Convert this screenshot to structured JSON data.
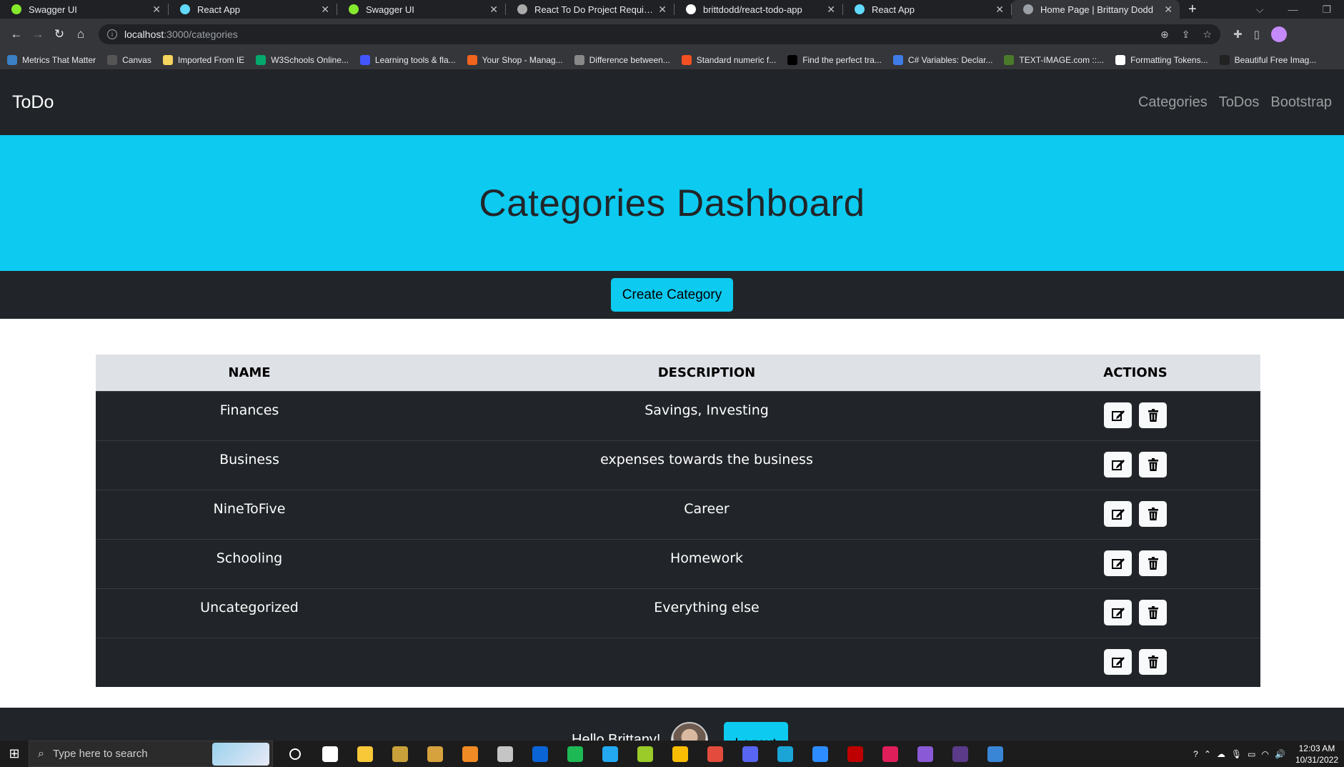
{
  "browser": {
    "tabs": [
      {
        "title": "Swagger UI",
        "icon": "swagger-icon",
        "color": "#85ea2d"
      },
      {
        "title": "React App",
        "icon": "react-icon",
        "color": "#61dafb"
      },
      {
        "title": "Swagger UI",
        "icon": "swagger-icon",
        "color": "#85ea2d"
      },
      {
        "title": "React To Do Project Requiremen",
        "icon": "canvas-icon",
        "color": "#aaaaaa"
      },
      {
        "title": "brittdodd/react-todo-app",
        "icon": "github-icon",
        "color": "#ffffff"
      },
      {
        "title": "React App",
        "icon": "react-icon",
        "color": "#61dafb"
      },
      {
        "title": "Home Page | Brittany Dodd",
        "icon": "globe-icon",
        "color": "#9aa0a6"
      }
    ],
    "active_tab": 6,
    "close_glyph": "✕",
    "new_tab_glyph": "+",
    "address": {
      "host": "localhost",
      "path": ":3000/categories"
    },
    "bookmarks": [
      {
        "label": "Metrics That Matter",
        "color": "#3b7fc4"
      },
      {
        "label": "Canvas",
        "color": "#555555"
      },
      {
        "label": "Imported From IE",
        "color": "#f4d35e"
      },
      {
        "label": "W3Schools Online...",
        "color": "#04aa6d"
      },
      {
        "label": "Learning tools & fla...",
        "color": "#4255ff"
      },
      {
        "label": "Your Shop - Manag...",
        "color": "#f1641e"
      },
      {
        "label": "Difference between...",
        "color": "#888888"
      },
      {
        "label": "Standard numeric f...",
        "color": "#f25022"
      },
      {
        "label": "Find the perfect tra...",
        "color": "#000000"
      },
      {
        "label": "C# Variables: Declar...",
        "color": "#3f7ce8"
      },
      {
        "label": "TEXT-IMAGE.com ::...",
        "color": "#4a7a2a"
      },
      {
        "label": "Formatting Tokens...",
        "color": "#ffffff"
      },
      {
        "label": "Beautiful Free Imag...",
        "color": "#222222"
      }
    ]
  },
  "navbar": {
    "brand": "ToDo",
    "links": [
      "Categories",
      "ToDos",
      "Bootstrap"
    ]
  },
  "hero": {
    "title": "Categories Dashboard"
  },
  "create_button": "Create Category",
  "table": {
    "headers": [
      "NAME",
      "DESCRIPTION",
      "ACTIONS"
    ],
    "rows": [
      {
        "name": "Finances",
        "description": "Savings, Investing"
      },
      {
        "name": "Business",
        "description": "expenses towards the business"
      },
      {
        "name": "NineToFive",
        "description": "Career"
      },
      {
        "name": "Schooling",
        "description": "Homework"
      },
      {
        "name": "Uncategorized",
        "description": "Everything else"
      },
      {
        "name": "",
        "description": ""
      }
    ]
  },
  "footer": {
    "greeting": "Hello Brittany!",
    "logout": "Logout"
  },
  "taskbar": {
    "search_placeholder": "Type here to search",
    "apps": [
      {
        "icon": "cortana-icon",
        "color": "#ffffff"
      },
      {
        "icon": "task-view-icon",
        "color": "#ffffff"
      },
      {
        "icon": "file-explorer-icon",
        "color": "#f8c839"
      },
      {
        "icon": "calculator-icon",
        "color": "#c8a13a"
      },
      {
        "icon": "snip-icon",
        "color": "#d6a23d"
      },
      {
        "icon": "office-icon",
        "color": "#f08a24"
      },
      {
        "icon": "git-icon",
        "color": "#c5c5c5"
      },
      {
        "icon": "outlook-icon",
        "color": "#0a64d6"
      },
      {
        "icon": "spotify-icon",
        "color": "#1db954"
      },
      {
        "icon": "vscode-icon",
        "color": "#23a9f2"
      },
      {
        "icon": "xbox-icon",
        "color": "#9bcb28"
      },
      {
        "icon": "chrome-icon",
        "color": "#fbbc04"
      },
      {
        "icon": "recorder-icon",
        "color": "#e34c3c"
      },
      {
        "icon": "discord-icon",
        "color": "#5865f2"
      },
      {
        "icon": "edge-icon",
        "color": "#1aa5d6"
      },
      {
        "icon": "zoom-icon",
        "color": "#2d8cff"
      },
      {
        "icon": "filezilla-icon",
        "color": "#bf0000"
      },
      {
        "icon": "slack-icon",
        "color": "#e01e5a"
      },
      {
        "icon": "visual-studio-icon",
        "color": "#8a5ad6"
      },
      {
        "icon": "terminal-icon",
        "color": "#5b3a8a"
      },
      {
        "icon": "photos-icon",
        "color": "#3a86d6"
      }
    ],
    "time": "12:03 AM",
    "date": "10/31/2022"
  },
  "colors": {
    "navbar_bg": "#212529",
    "hero_bg": "#0dcaf0",
    "table_header_bg": "#dee2e6",
    "table_row_bg": "#212529"
  }
}
